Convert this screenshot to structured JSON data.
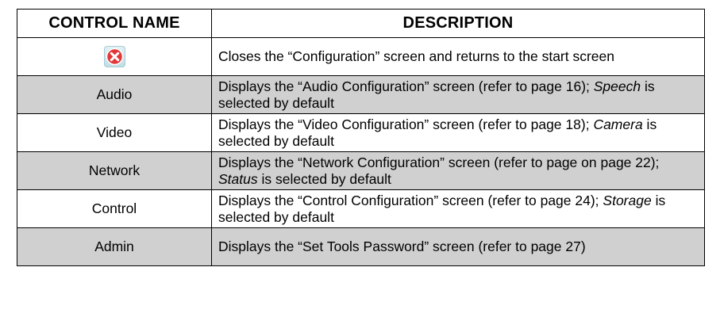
{
  "table": {
    "headers": [
      "CONTROL NAME",
      "DESCRIPTION"
    ],
    "rows": [
      {
        "name": "",
        "icon": "close-icon",
        "desc": [
          "Closes the “Configuration” screen and returns to the start screen"
        ]
      },
      {
        "name": "Audio",
        "desc": [
          "Displays the “Audio Configuration” screen (refer to page 16); ",
          "Speech",
          " is selected by default"
        ]
      },
      {
        "name": "Video",
        "desc": [
          "Displays the “Video Configuration” screen (refer to page 18); ",
          "Camera",
          " is selected by default"
        ]
      },
      {
        "name": "Network",
        "desc": [
          "Displays the “Network Configuration” screen (refer to page on page 22); ",
          "Status",
          " is selected by default"
        ]
      },
      {
        "name": "Control",
        "desc": [
          "Displays the “Control Configuration” screen (refer to page 24); ",
          "Storage",
          " is selected by default"
        ]
      },
      {
        "name": "Admin",
        "desc": [
          "Displays the “Set Tools Password” screen (refer to page 27)"
        ]
      }
    ]
  },
  "colors": {
    "shade": "#d0d0d0",
    "icon_red": "#e2383a"
  }
}
